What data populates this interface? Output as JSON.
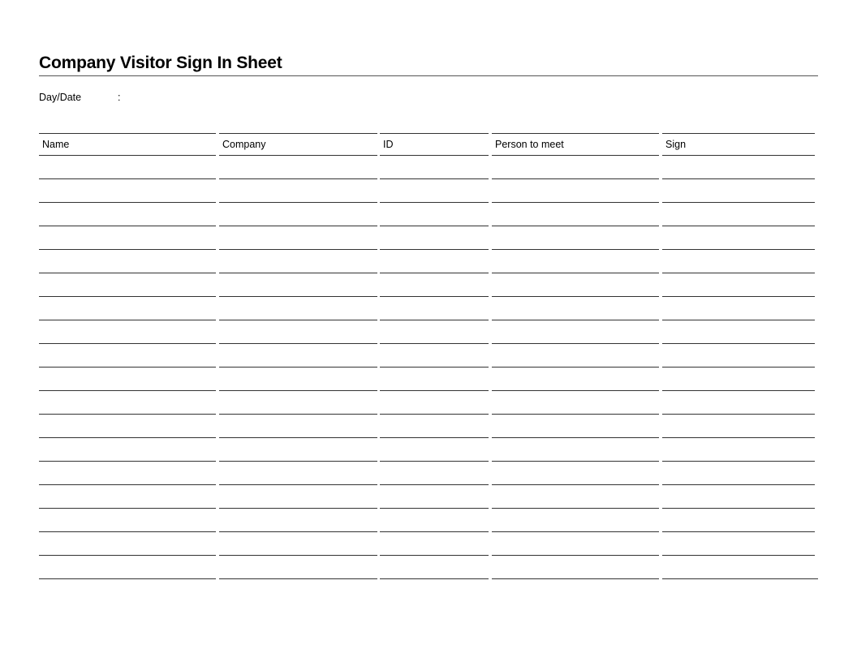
{
  "document": {
    "title": "Company Visitor Sign In Sheet",
    "date_label": "Day/Date",
    "date_separator": ":",
    "date_value": ""
  },
  "table": {
    "columns": [
      {
        "key": "name",
        "label": "Name"
      },
      {
        "key": "company",
        "label": "Company"
      },
      {
        "key": "id",
        "label": "ID"
      },
      {
        "key": "person_to_meet",
        "label": "Person to meet"
      },
      {
        "key": "sign",
        "label": "Sign"
      }
    ],
    "blank_rows": 18
  }
}
